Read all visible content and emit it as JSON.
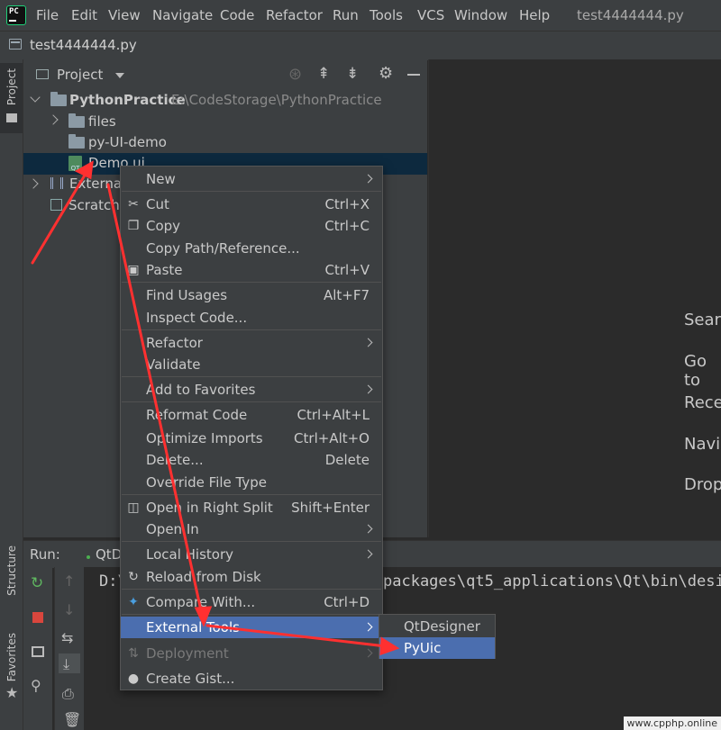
{
  "menubar": {
    "logo_text": "PC",
    "items": [
      "File",
      "Edit",
      "View",
      "Navigate",
      "Code",
      "Refactor",
      "Run",
      "Tools",
      "VCS",
      "Window",
      "Help"
    ],
    "window_title": "test4444444.py"
  },
  "tab": {
    "file": "test4444444.py"
  },
  "stripe": {
    "project": "Project",
    "structure": "Structure",
    "favorites": "Favorites"
  },
  "project_panel": {
    "title": "Project",
    "root": {
      "name": "PythonPractice",
      "path": "E:\\CodeStorage\\PythonPractice"
    },
    "items": [
      "files",
      "py-UI-demo",
      "Demo.ui",
      "External",
      "Scratche"
    ]
  },
  "editor_hints": [
    "Searc",
    "Go to",
    "Rece",
    "Navi",
    "Drop"
  ],
  "run_panel": {
    "label": "Run:",
    "tab": "QtD",
    "console_prefix": "D:\\",
    "console_suffix": "packages\\qt5_applications\\Qt\\bin\\desi"
  },
  "context_menu": {
    "items": [
      {
        "label": "New",
        "shortcut": ""
      },
      {
        "label": "Cut",
        "shortcut": "Ctrl+X"
      },
      {
        "label": "Copy",
        "shortcut": "Ctrl+C"
      },
      {
        "label": "Copy Path/Reference...",
        "shortcut": ""
      },
      {
        "label": "Paste",
        "shortcut": "Ctrl+V"
      },
      {
        "label": "Find Usages",
        "shortcut": "Alt+F7"
      },
      {
        "label": "Inspect Code...",
        "shortcut": ""
      },
      {
        "label": "Refactor",
        "shortcut": ""
      },
      {
        "label": "Validate",
        "shortcut": ""
      },
      {
        "label": "Add to Favorites",
        "shortcut": ""
      },
      {
        "label": "Reformat Code",
        "shortcut": "Ctrl+Alt+L"
      },
      {
        "label": "Optimize Imports",
        "shortcut": "Ctrl+Alt+O"
      },
      {
        "label": "Delete...",
        "shortcut": "Delete"
      },
      {
        "label": "Override File Type",
        "shortcut": ""
      },
      {
        "label": "Open in Right Split",
        "shortcut": "Shift+Enter"
      },
      {
        "label": "Open In",
        "shortcut": ""
      },
      {
        "label": "Local History",
        "shortcut": ""
      },
      {
        "label": "Reload from Disk",
        "shortcut": ""
      },
      {
        "label": "Compare With...",
        "shortcut": "Ctrl+D"
      },
      {
        "label": "External Tools",
        "shortcut": ""
      },
      {
        "label": "Deployment",
        "shortcut": ""
      },
      {
        "label": "Create Gist...",
        "shortcut": ""
      }
    ]
  },
  "submenu": {
    "items": [
      "QtDesigner",
      "PyUic"
    ]
  },
  "watermark": "www.cpphp.online",
  "colors": {
    "selection": "#4b6eaf",
    "annotation_arrow": "#ff3030"
  }
}
